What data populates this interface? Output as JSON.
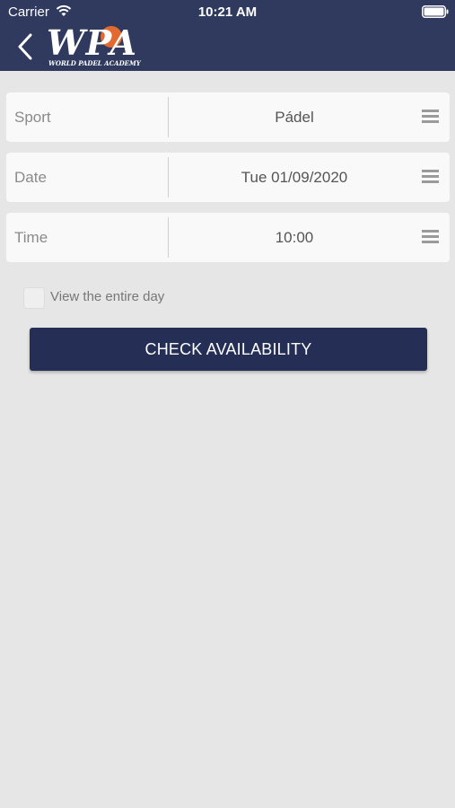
{
  "status_bar": {
    "carrier": "Carrier",
    "time": "10:21 AM",
    "wifi_icon": "wifi-icon",
    "battery_icon": "battery-icon"
  },
  "header": {
    "back_icon": "chevron-left-icon",
    "logo_text": "WPA",
    "logo_subtitle": "WORLD PADEL ACADEMY",
    "background_color": "#2f3a5e",
    "logo_accent_color": "#e36a2e"
  },
  "form": {
    "rows": [
      {
        "label": "Sport",
        "value": "Pádel",
        "icon": "menu-icon"
      },
      {
        "label": "Date",
        "value": "Tue 01/09/2020",
        "icon": "menu-icon"
      },
      {
        "label": "Time",
        "value": "10:00",
        "icon": "menu-icon"
      }
    ],
    "entire_day": {
      "label": "View the entire day",
      "checked": false
    },
    "submit_label": "CHECK AVAILABILITY",
    "button_color": "#252f56"
  }
}
